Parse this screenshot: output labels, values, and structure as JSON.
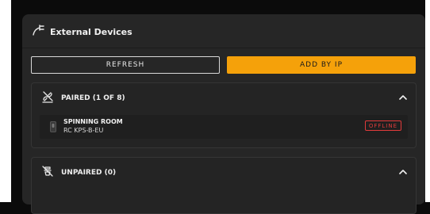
{
  "panel": {
    "title": "External Devices",
    "icon": "cast-icon"
  },
  "actions": {
    "refresh_label": "REFRESH",
    "add_by_ip_label": "ADD BY IP",
    "accent_color": "#f5a10a"
  },
  "paired": {
    "label": "PAIRED (1 OF 8)",
    "icon": "link-off-icon",
    "expanded": true,
    "devices": [
      {
        "name": "SPINNING ROOM",
        "model": "RC KPS-B-EU",
        "status": "OFFLINE",
        "status_color": "#e23b3b"
      }
    ]
  },
  "unpaired": {
    "label": "UNPAIRED (0)",
    "icon": "unpaired-icon",
    "expanded": true
  }
}
